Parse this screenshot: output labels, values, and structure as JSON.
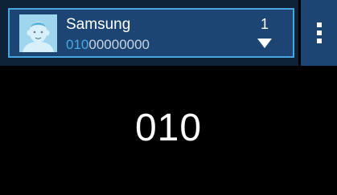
{
  "contact": {
    "name": "Samsung",
    "number_match": "010",
    "number_rest": "00000000",
    "result_count": "1",
    "avatar_icon": "default-contact-avatar-icon",
    "dropdown_icon": "triangle-down-icon"
  },
  "menu": {
    "icon": "more-options-icon"
  },
  "dialer": {
    "entered_digits": "010"
  },
  "colors": {
    "card_background": "#1d4574",
    "card_border": "#47a6dd",
    "match_highlight": "#4aa8e2",
    "display_background": "#000000"
  }
}
